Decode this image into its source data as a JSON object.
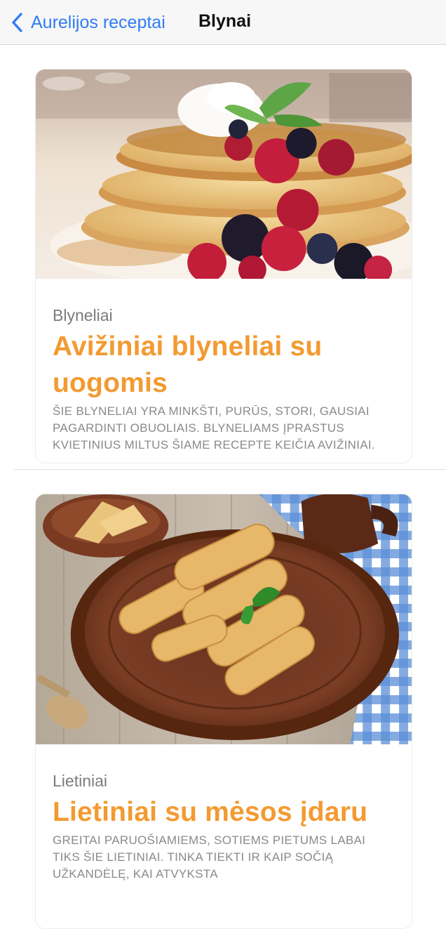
{
  "navbar": {
    "back_label": "Aurelijos receptai",
    "title": "Blynai"
  },
  "recipes": [
    {
      "category": "Blyneliai",
      "title": "Avižiniai blyneliai su uogomis",
      "description": "Šie blyneliai yra minkšti, purūs, stori, gausiai pagardinti obuoliais. Blyneliams įprastus kvietinius miltus šiame recepte keičia avižiniai."
    },
    {
      "category": "Lietiniai",
      "title": "Lietiniai su mėsos įdaru",
      "description": "Greitai paruošiamiems, sotiems pietums labai tiks šie lietiniai. Tinka tiekti ir kaip sočią užkandėlę, kai atvyksta"
    }
  ],
  "colors": {
    "accent": "#2f7cf6",
    "title_orange": "#f39a31"
  }
}
